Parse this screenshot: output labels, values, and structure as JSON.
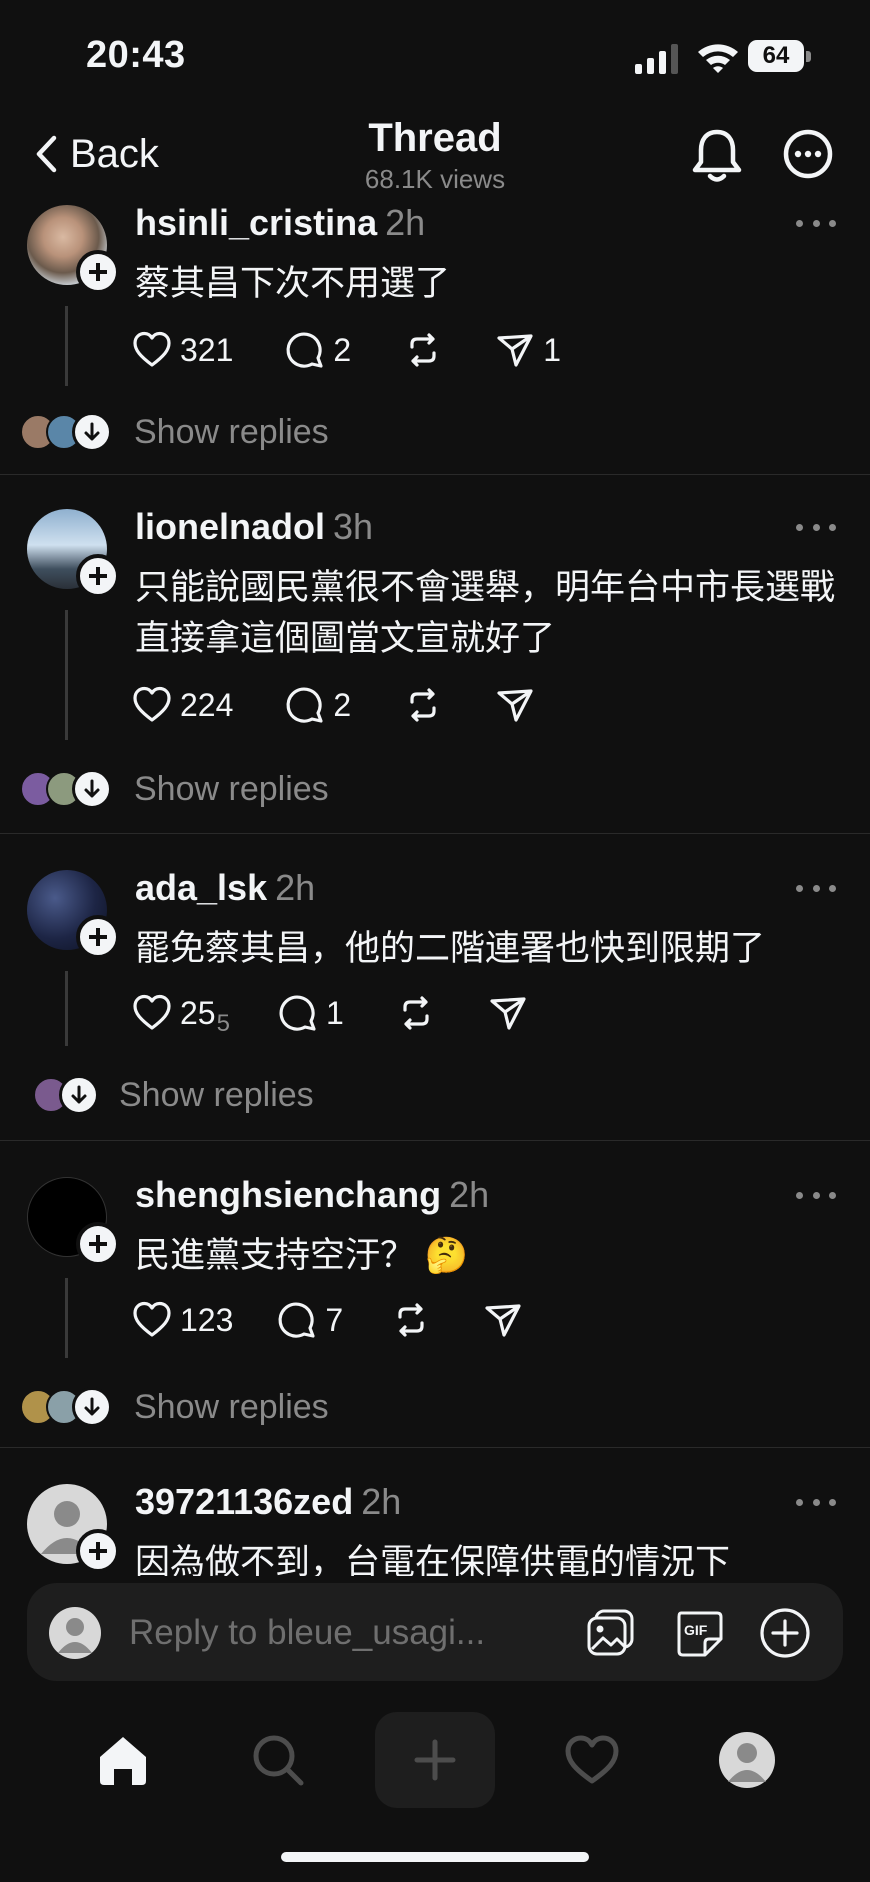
{
  "status_bar": {
    "time": "20:43",
    "battery": "64"
  },
  "nav": {
    "back_label": "Back",
    "title": "Thread",
    "views": "68.1K views"
  },
  "posts": [
    {
      "username": "hsinli_cristina",
      "time": "2h",
      "text": "蔡其昌下次不用選了",
      "likes": "321",
      "replies": "2",
      "shares": "1",
      "show_replies": "Show replies"
    },
    {
      "username": "lionelnadol",
      "time": "3h",
      "text": "只能說國民黨很不會選舉，明年台中市長選戰直接拿這個圖當文宣就好了",
      "likes": "224",
      "replies": "2",
      "shares": "",
      "show_replies": "Show replies"
    },
    {
      "username": "ada_lsk",
      "time": "2h",
      "text": "罷免蔡其昌，他的二階連署也快到限期了",
      "likes": "25",
      "likes_sub": "5",
      "replies": "1",
      "shares": "",
      "show_replies": "Show replies"
    },
    {
      "username": "shenghsienchang",
      "time": "2h",
      "text": "民進黨支持空汙？ 🤔",
      "likes": "123",
      "replies": "7",
      "shares": "",
      "show_replies": "Show replies"
    },
    {
      "username": "39721136zed",
      "time": "2h",
      "text": "因為做不到，台電在保障供電的情況下"
    }
  ],
  "reply_bar": {
    "placeholder": "Reply to bleue_usagi..."
  },
  "icons": {
    "back": "chevron-left-icon",
    "bell": "bell-icon",
    "more": "more-circle-icon",
    "like": "heart-icon",
    "comment": "comment-icon",
    "repost": "repost-icon",
    "share": "send-icon",
    "image": "image-icon",
    "gif": "gif-icon",
    "add": "plus-circle-icon",
    "home": "home-icon",
    "search": "search-icon",
    "create": "plus-icon",
    "activity": "heart-icon",
    "profile": "profile-icon"
  },
  "colors": {
    "background": "#101010",
    "text": "#f3f5f7",
    "muted": "#8a8a8a",
    "surface": "#1e1e1e"
  }
}
